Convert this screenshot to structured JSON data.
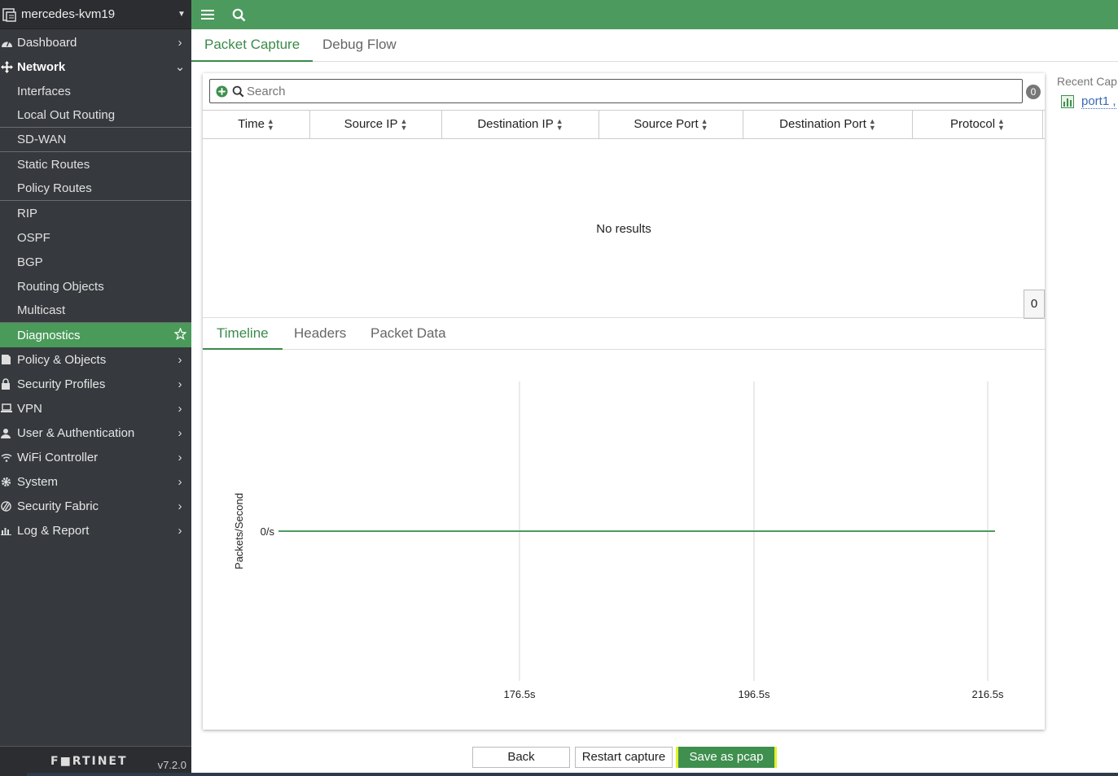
{
  "sidebar": {
    "device_name": "mercedes-kvm19",
    "items": [
      {
        "label": "Dashboard",
        "icon": "dashboard-icon"
      },
      {
        "label": "Network",
        "icon": "network-icon"
      }
    ],
    "network_sub": [
      "Interfaces",
      "Local Out Routing",
      "SD-WAN",
      "Static Routes",
      "Policy Routes",
      "RIP",
      "OSPF",
      "BGP",
      "Routing Objects",
      "Multicast",
      "Diagnostics"
    ],
    "bottom_items": [
      "Policy & Objects",
      "Security Profiles",
      "VPN",
      "User & Authentication",
      "WiFi Controller",
      "System",
      "Security Fabric",
      "Log & Report"
    ],
    "logo": "F■RTINET",
    "version": "v7.2.0",
    "accent_color": "#4a9a5a"
  },
  "tabs": {
    "packet_capture": "Packet Capture",
    "debug_flow": "Debug Flow"
  },
  "search": {
    "placeholder": "Search",
    "count": "0"
  },
  "table": {
    "columns": [
      "Time",
      "Source IP",
      "Destination IP",
      "Source Port",
      "Destination Port",
      "Protocol"
    ],
    "empty_text": "No results",
    "row_count": "0"
  },
  "detail_tabs": {
    "timeline": "Timeline",
    "headers": "Headers",
    "packet_data": "Packet Data"
  },
  "chart_data": {
    "type": "line",
    "title": "",
    "ylabel": "Packets/Second",
    "xlabel": "",
    "y_tick": "0/s",
    "x_ticks": [
      "176.5s",
      "196.5s",
      "216.5s"
    ],
    "series": [
      {
        "values": [
          0,
          0,
          0
        ]
      }
    ]
  },
  "recent": {
    "title": "Recent Cap",
    "link": "port1 ,"
  },
  "buttons": {
    "back": "Back",
    "restart": "Restart capture",
    "save": "Save as pcap"
  }
}
